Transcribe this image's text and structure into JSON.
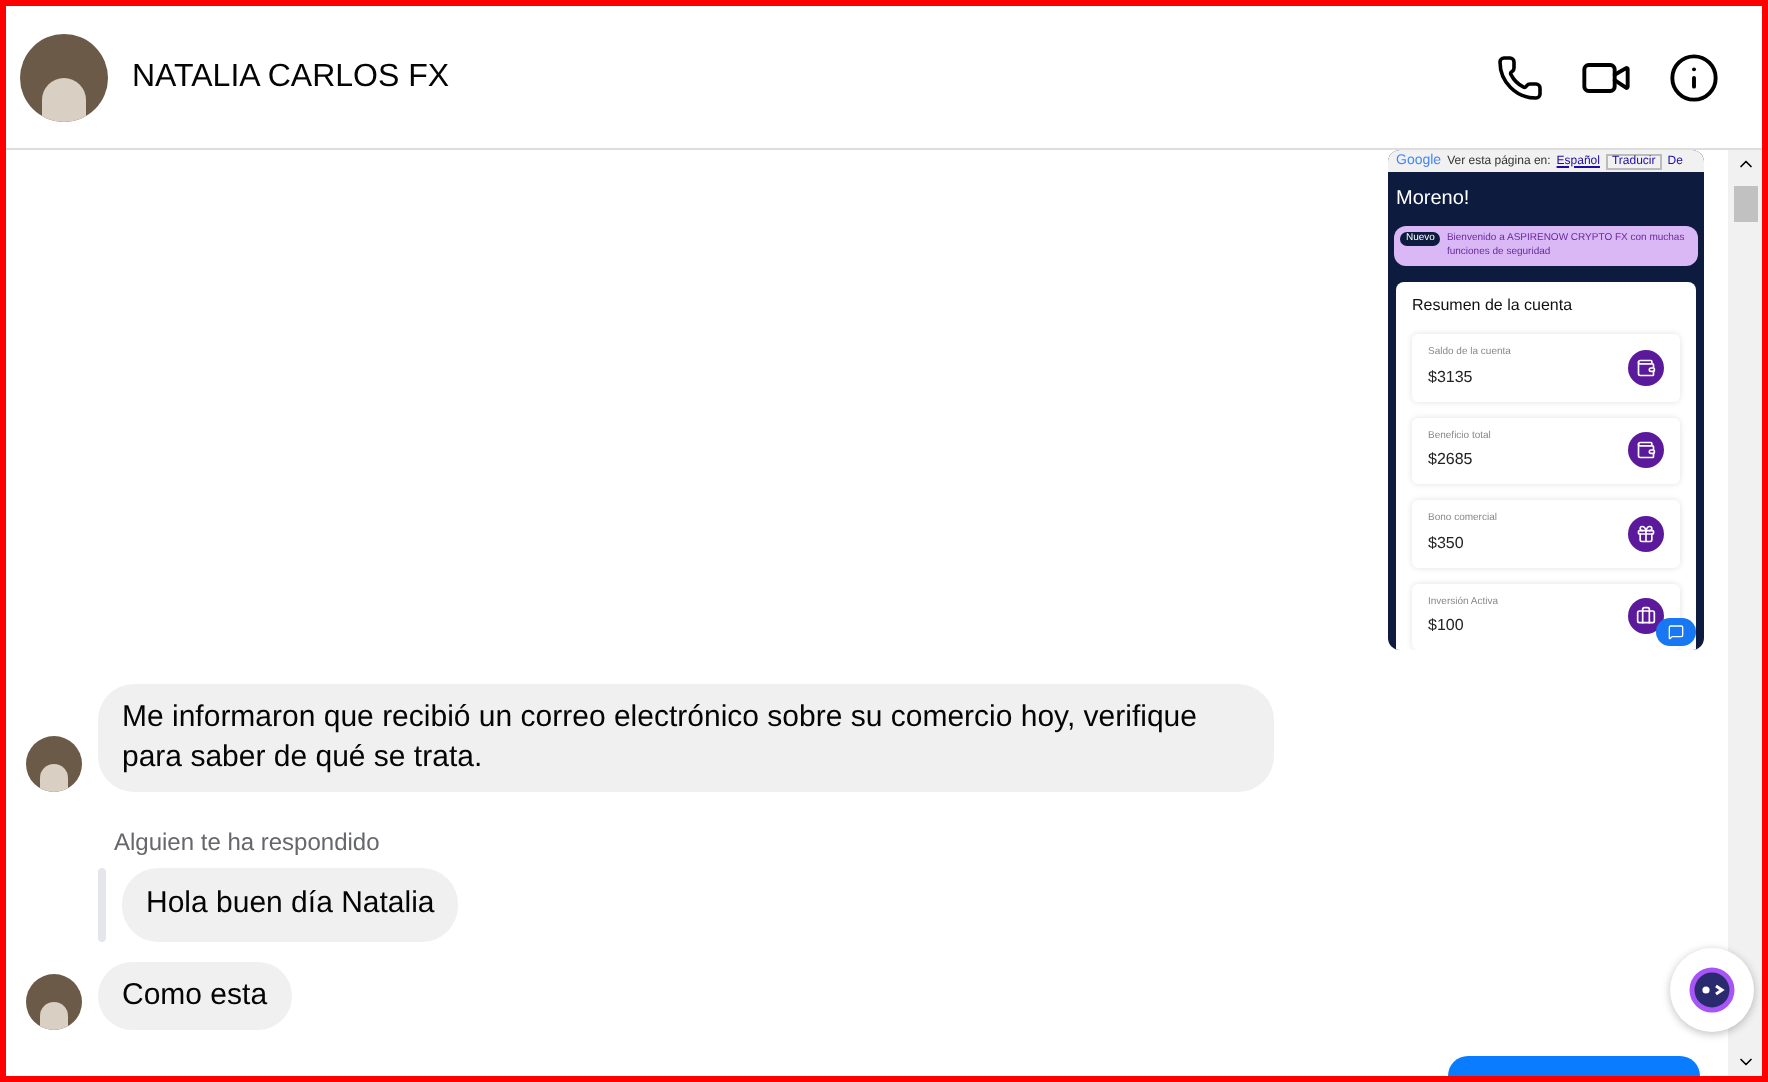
{
  "header": {
    "contact_name": "NATALIA CARLOS FX"
  },
  "shared_image": {
    "translate_bar": {
      "brand": "Google",
      "prompt": "Ver esta página en:",
      "language": "Español",
      "translate_button": "Traducir",
      "cut_button": "De"
    },
    "greeting": "Moreno!",
    "notice": {
      "badge": "Nuevo",
      "text": "Bienvenido a ASPIRENOW CRYPTO FX con muchas funciones de seguridad"
    },
    "summary_title": "Resumen de la cuenta",
    "cards": [
      {
        "label": "Saldo de la cuenta",
        "value": "$3135",
        "kind": "wallet"
      },
      {
        "label": "Beneficio total",
        "value": "$2685",
        "kind": "wallet"
      },
      {
        "label": "Bono comercial",
        "value": "$350",
        "kind": "gift"
      },
      {
        "label": "Inversión Activa",
        "value": "$100",
        "kind": "briefcase"
      }
    ]
  },
  "messages": [
    {
      "kind": "incoming",
      "text": "Me informaron que recibió un correo electrónico sobre su comercio hoy, verifique para saber de qué se trata.",
      "avatar": true
    },
    {
      "kind": "reply_note",
      "text": "Alguien te ha respondido"
    },
    {
      "kind": "quoted",
      "text": "Hola buen día Natalia"
    },
    {
      "kind": "incoming",
      "text": "Como esta",
      "avatar": true
    }
  ]
}
